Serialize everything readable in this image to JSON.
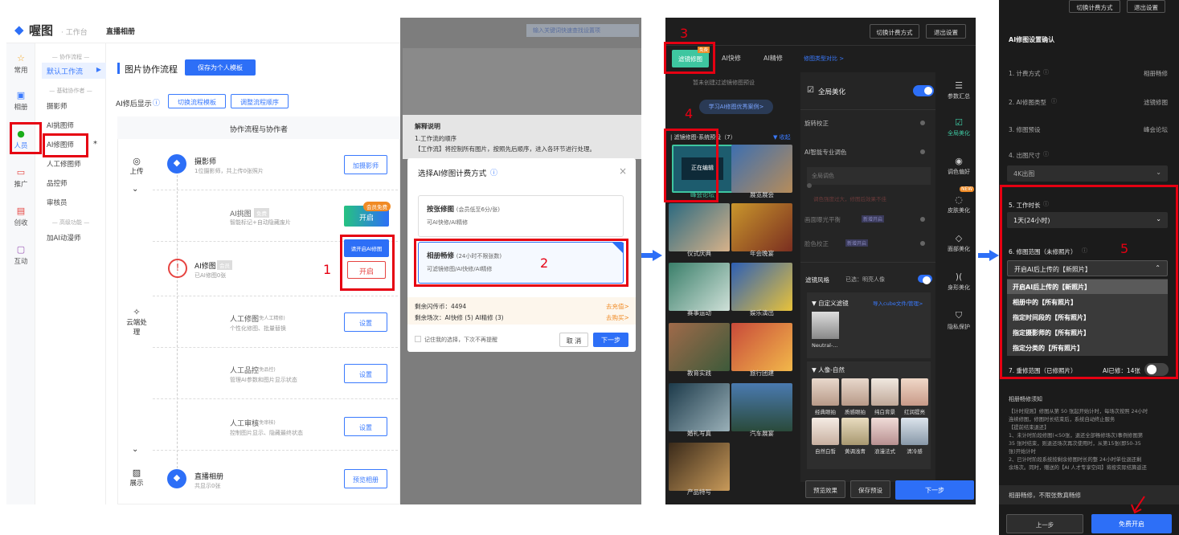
{
  "panel1": {
    "logo": "喔图",
    "logo_sub": "· 工作台",
    "breadcrumb": "直播相册",
    "left_nav": [
      "常用",
      "相册",
      "人员",
      "推广",
      "创收",
      "互动"
    ],
    "sub_groups": [
      "— 协作流程 —",
      "— 基础协作者 —",
      "— 高级功能 —"
    ],
    "sub_items": [
      "默认工作流",
      "摄影师",
      "AI挑图师",
      "AI修图师",
      "人工修图师",
      "品控师",
      "审核员",
      "加AI动漫师"
    ],
    "star": "*",
    "title": "图片协作流程",
    "save_btn": "保存为个人模板",
    "ai_display": "AI修后显示",
    "switch_btn": "切换流程模板",
    "adjust_btn": "调整流程顺序",
    "flow_head": "协作流程与协作者",
    "stages": [
      "上传",
      "云端处理",
      "展示"
    ],
    "roles": [
      {
        "title": "摄影师",
        "sub": "1位摄影师，共上传0张照片",
        "btn": "加摄影师"
      },
      {
        "title": "AI挑图",
        "tag": "免费",
        "sub": "智能标记+自动隐藏废片",
        "btn": "开启",
        "badge": "会员免费"
      },
      {
        "title": "AI修图",
        "tag": "会员",
        "sub": "已AI修图0张",
        "btn": "开启",
        "tip": "请开启AI修图"
      },
      {
        "title": "人工修图",
        "tag": "(免人工精修)",
        "sub": "个性化修图、批量替换",
        "btn": "设置"
      },
      {
        "title": "人工品控",
        "tag": "(免品控)",
        "sub": "管理AI参数和图片显示状态",
        "btn": "设置"
      },
      {
        "title": "人工审核",
        "tag": "(免审核)",
        "sub": "控制图片显示、隐藏最终状态",
        "btn": "设置"
      },
      {
        "title": "直播相册",
        "sub": "共显示0张",
        "btn": "预览相册"
      }
    ],
    "marker": "1"
  },
  "panel2": {
    "search_placeholder": "输入关键词快速查找设置项",
    "explain_title": "解释说明",
    "explain_lines": [
      "1.工作流的顺序",
      "【工作流】将控制所有图片，按照先后顺序，进入各环节进行处理。"
    ],
    "dialog_title": "选择AI修图计费方式",
    "close": "×",
    "opt1_title": "按张修图",
    "opt1_note": "(会员低至6分/张)",
    "opt1_sub": "可AI快修/AI精修",
    "opt2_title": "相册畅修",
    "opt2_note": "(24小时不限张数)",
    "opt2_sub": "可滤镜修图/AI快修/AI精修",
    "balance1": "剩余闪传币：4494",
    "balance1_link": "去充值>",
    "balance2": "剩余场次：AI快修 (5) AI精修 (3)",
    "balance2_link": "去购买>",
    "remember": "记住我的选择，下次不再提醒",
    "cancel": "取 消",
    "next": "下一步",
    "marker": "2"
  },
  "panel3": {
    "switch_btn": "切换计费方式",
    "exit_btn": "退出设置",
    "tabs": [
      "滤镜修图",
      "AI快修",
      "AI精修"
    ],
    "tab_badge": "免费",
    "compare": "修图类型对比 >",
    "empty_tip": "暂未创建过滤镜修图预设",
    "learn_btn": "学习AI修图优秀案例>",
    "preset_header": "| 滤镜修图-系统预设（7）",
    "collapse": "▼ 收起",
    "presets": [
      "峰会论坛",
      "展览展会",
      "仪式庆典",
      "年会晚宴",
      "赛事运动",
      "娱乐演出",
      "教育实践",
      "旅行团建",
      "婚礼写真",
      "汽车展宴",
      "产品特写"
    ],
    "processing": "正在编辑",
    "global": "全局美化",
    "settings": [
      "旋转校正",
      "AI智能专业调色",
      "全局调色",
      "调色强度过大，修图后效果不佳",
      "画面曝光平衡",
      "脸色校正"
    ],
    "tag_open": "新增开启",
    "filter_style": "滤镜风格",
    "filter_selected": "已选：明亮人像",
    "custom_filter": "▼ 自定义滤镜",
    "import_link": "导入cube文件/管理>",
    "neutral": "Neutral-...",
    "natural": "▼ 人像-自然",
    "faces": [
      "经典眼拍",
      "质感眼拍",
      "纯白背景",
      "红润提亮",
      "自然白皙",
      "黄调浅青",
      "浪漫法式",
      "清冷感"
    ],
    "tools": [
      "参数汇总",
      "全局美化",
      "调色偏好",
      "皮肤美化",
      "面部美化",
      "身形美化",
      "隐私保护"
    ],
    "tool_new": "NEW",
    "preview": "预览效果",
    "save_preset": "保存预设",
    "next": "下一步",
    "markers": [
      "3",
      "4"
    ]
  },
  "panel4": {
    "switch_btn": "切换计费方式",
    "exit_btn": "退出设置",
    "title": "AI修图设置确认",
    "rows": [
      {
        "label": "1. 计费方式",
        "value": "相册畅修"
      },
      {
        "label": "2. AI修图类型",
        "value": "滤镜修图"
      },
      {
        "label": "3. 修图预设",
        "value": "峰会论坛"
      },
      {
        "label": "4. 出图尺寸",
        "value": ""
      }
    ],
    "size_value": "4K出图",
    "worktime_label": "5. 工作时长",
    "worktime_value": "1天(24小时)",
    "range_label": "6. 修图范围（未修照片）",
    "range_value": "开启AI后上传的【新照片】",
    "range_options": [
      "开启AI后上传的【新照片】",
      "相册中的【所有照片】",
      "指定时间段的【所有照片】",
      "指定摄影师的【所有照片】",
      "指定分类的【所有照片】"
    ],
    "repair_label": "7. 重修范围（已修照片）",
    "repair_count": "AI已修：14张",
    "notice_title": "相册畅修须知",
    "notice_lines": [
      "【计时规则】修图从第 50 张起开始计时，每场次按照 24小时",
      "连续修图，修图时长结束后，系统自动终止服务",
      "【提前结束退还】",
      "1、未计时阶段修图(<50张，退还全部畅修场次)事例修图第",
      "35 张时结束，则退还场次再次使用时，从第15张(即50-35",
      "张)开始计时",
      "2、已计时阶段系统按剩余修图时长的整 24小时单位退还剩",
      "余场次。同时，赠送的【AI 人才专享空间】将按实际结算返还"
    ],
    "footer_tip": "相册畅修，不限张数真畅修",
    "prev": "上一步",
    "start": "免费开启",
    "marker": "5"
  },
  "colors": {
    "accent": "#2d6ff7",
    "marker": "#e60012",
    "dark": "#1e1e1e"
  }
}
